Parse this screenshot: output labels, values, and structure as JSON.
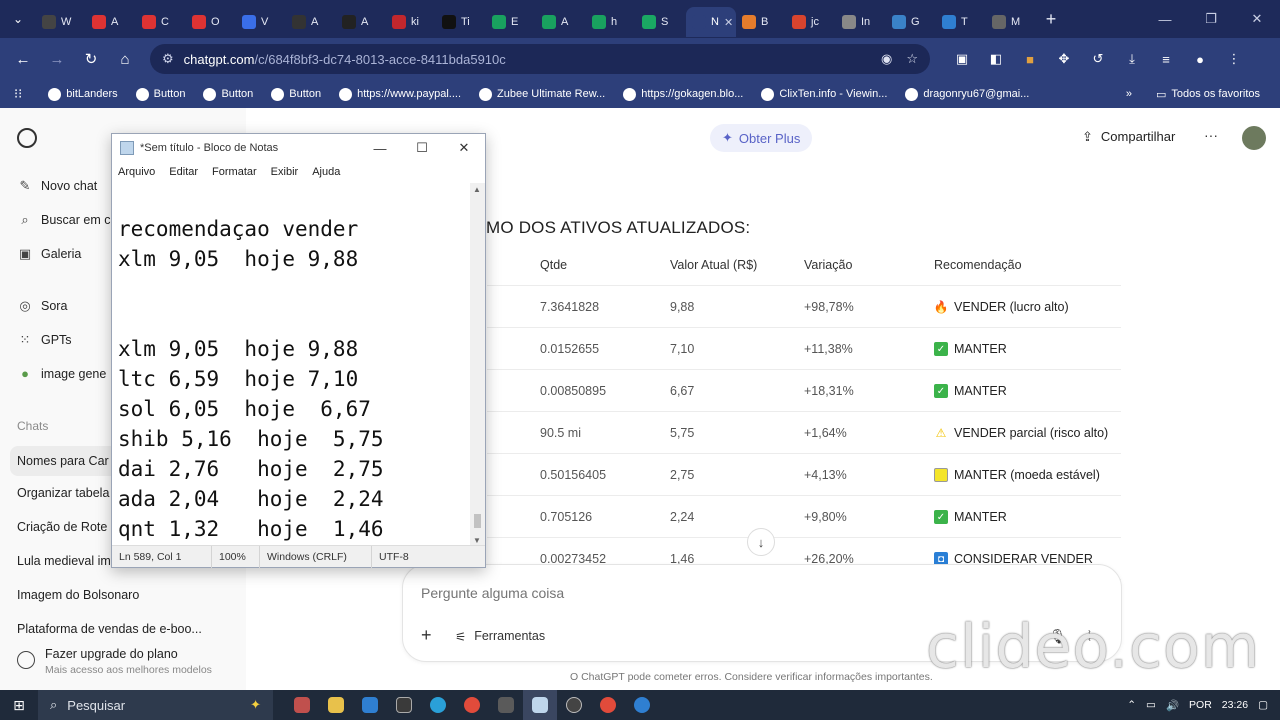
{
  "browser": {
    "tabs": [
      {
        "label": "W",
        "fav": "#444"
      },
      {
        "label": "A",
        "fav": "#d33"
      },
      {
        "label": "C",
        "fav": "#d33"
      },
      {
        "label": "O",
        "fav": "#d33"
      },
      {
        "label": "V",
        "fav": "#3a6ee8"
      },
      {
        "label": "A",
        "fav": "#333"
      },
      {
        "label": "A",
        "fav": "#222"
      },
      {
        "label": "ki",
        "fav": "#c1272d"
      },
      {
        "label": "Ti",
        "fav": "#111"
      },
      {
        "label": "E",
        "fav": "#19a15f"
      },
      {
        "label": "A",
        "fav": "#19a15f"
      },
      {
        "label": "h",
        "fav": "#19a15f"
      },
      {
        "label": "S",
        "fav": "#1aa863"
      },
      {
        "label": "N",
        "fav": "#2d3f7a",
        "active": true
      },
      {
        "label": "B",
        "fav": "#e57c2c"
      },
      {
        "label": "jc",
        "fav": "#d8442e"
      },
      {
        "label": "In",
        "fav": "#888"
      },
      {
        "label": "G",
        "fav": "#3a82c8"
      },
      {
        "label": "T",
        "fav": "#2f7fd1"
      },
      {
        "label": "M",
        "fav": "#666"
      }
    ],
    "new_tab": "+",
    "url_host": "chatgpt.com",
    "url_path": "/c/684f8bf3-dc74-8013-acce-8411bda5910c",
    "bookmarks": [
      "bitLanders",
      "Button",
      "Button",
      "Button",
      "https://www.paypal....",
      "Zubee Ultimate Rew...",
      "https://gokagen.blo...",
      "ClixTen.info - Viewin...",
      "dragonryu67@gmai..."
    ],
    "bookmarks_more": "»",
    "all_favorites": "Todos os favoritos"
  },
  "sidebar": {
    "items": [
      {
        "icon": "edit-icon",
        "label": "Novo chat",
        "glyph": "✎"
      },
      {
        "icon": "search-icon",
        "label": "Buscar em c",
        "glyph": "⌕"
      },
      {
        "icon": "gallery-icon",
        "label": "Galeria",
        "glyph": "▣"
      }
    ],
    "tools": [
      {
        "icon": "sora-icon",
        "label": "Sora",
        "glyph": "◎"
      },
      {
        "icon": "gpts-icon",
        "label": "GPTs",
        "glyph": "⁙"
      },
      {
        "icon": "image-gen-icon",
        "label": "image gene",
        "glyph": "●"
      }
    ],
    "chats_heading": "Chats",
    "chats": [
      "Nomes para Car",
      "Organizar tabela",
      "Criação de Rote",
      "Lula medieval im",
      "Imagem do Bolsonaro",
      "Plataforma de vendas de e-boo..."
    ],
    "upgrade_title": "Fazer upgrade do plano",
    "upgrade_subtitle": "Mais acesso aos melhores modelos"
  },
  "header": {
    "plus_label": "Obter Plus",
    "share_label": "Compartilhar",
    "more_label": "···"
  },
  "summary": {
    "title": "MO DOS ATIVOS ATUALIZADOS:",
    "columns": [
      "Qtde",
      "Valor Atual (R$)",
      "Variação",
      "Recomendação"
    ],
    "rows": [
      {
        "qtd": "7.3641828",
        "valor": "9,88",
        "var": "+98,78%",
        "rec": "VENDER (lucro alto)",
        "icon": "fire-icon",
        "glyph": "🔥",
        "color": "#ff7a1a"
      },
      {
        "qtd": "0.0152655",
        "valor": "7,10",
        "var": "+11,38%",
        "rec": "MANTER",
        "icon": "check-icon",
        "glyph": "✓",
        "color": "#3bb34a"
      },
      {
        "qtd": "0.00850895",
        "valor": "6,67",
        "var": "+18,31%",
        "rec": "MANTER",
        "icon": "check-icon",
        "glyph": "✓",
        "color": "#3bb34a"
      },
      {
        "qtd": "90.5 mi",
        "valor": "5,75",
        "var": "+1,64%",
        "rec": "VENDER parcial (risco alto)",
        "icon": "warning-icon",
        "glyph": "⚠",
        "color": "#f2c200"
      },
      {
        "qtd": "0.50156405",
        "valor": "2,75",
        "var": "+4,13%",
        "rec": "MANTER (moeda estável)",
        "icon": "square-icon",
        "glyph": "",
        "color": "#f4e52a"
      },
      {
        "qtd": "0.705126",
        "valor": "2,24",
        "var": "+9,80%",
        "rec": "MANTER",
        "icon": "check-icon",
        "glyph": "✓",
        "color": "#3bb34a"
      },
      {
        "qtd": "0.00273452",
        "valor": "1,46",
        "var": "+26,20%",
        "rec": "CONSIDERAR VENDER",
        "icon": "info-icon",
        "glyph": "◘",
        "color": "#2a7fd6"
      }
    ]
  },
  "composer": {
    "placeholder": "Pergunte alguma coisa",
    "plus": "+",
    "tools_label": "Ferramentas",
    "disclaimer": "O ChatGPT pode cometer erros. Considere verificar informações importantes."
  },
  "notepad": {
    "title": "*Sem título - Bloco de Notas",
    "menu": [
      "Arquivo",
      "Editar",
      "Formatar",
      "Exibir",
      "Ajuda"
    ],
    "lines": [
      "recomendaçao vender",
      "xlm 9,05  hoje 9,88",
      "",
      "",
      "xlm 9,05  hoje 9,88",
      "ltc 6,59  hoje 7,10",
      "sol 6,05  hoje  6,67",
      "shib 5,16  hoje  5,75",
      "dai 2,76   hoje  2,75",
      "ada 2,04   hoje  2,24",
      "qnt 1,32   hoje  1,46"
    ],
    "status": {
      "position": "Ln 589, Col 1",
      "zoom": "100%",
      "eol": "Windows (CRLF)",
      "encoding": "UTF-8"
    }
  },
  "watermark": "clideo.com",
  "taskbar": {
    "search_label": "Pesquisar",
    "language": "POR",
    "time": "23:26"
  }
}
